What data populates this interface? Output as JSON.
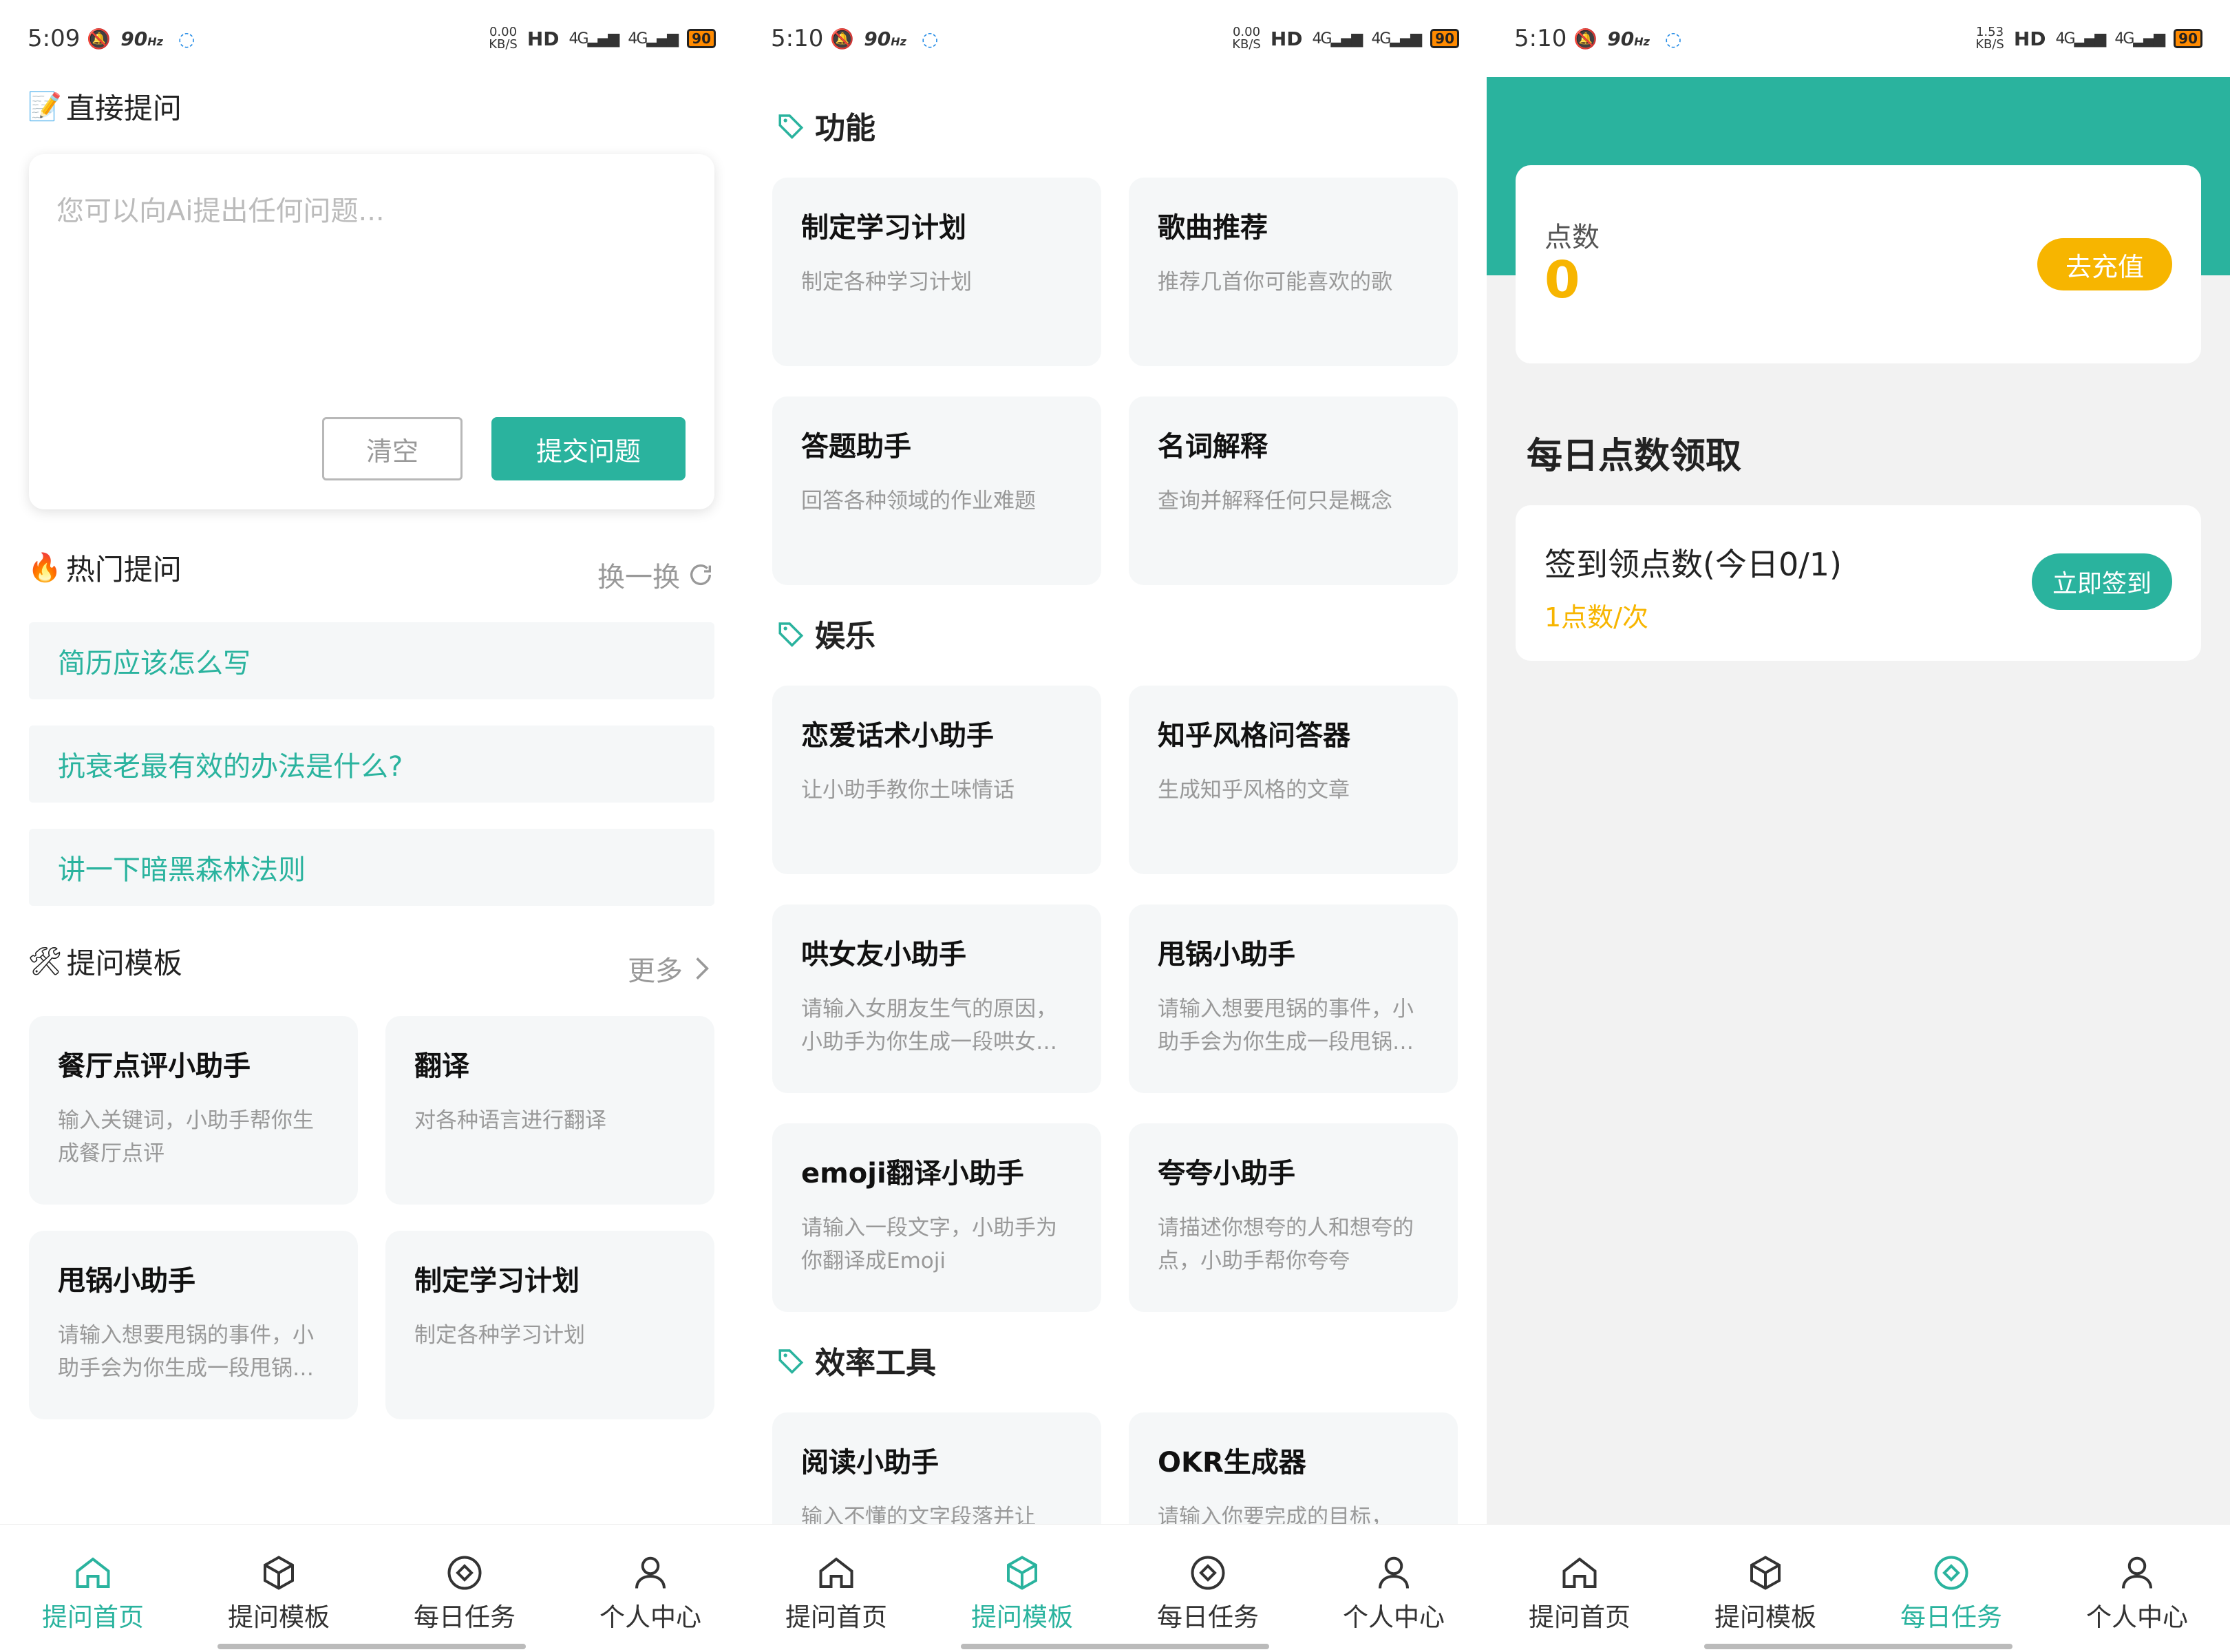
{
  "screens": [
    {
      "status": {
        "time": "5:09",
        "hz": "90",
        "hz_unit": "Hz",
        "speed": "0.00",
        "speed_unit": "KB/S",
        "hd": "HD",
        "net1": "4G",
        "net2": "4G",
        "battery": "90"
      },
      "ask": {
        "title": "直接提问",
        "placeholder": "您可以向Ai提出任何问题...",
        "clear_label": "清空",
        "submit_label": "提交问题"
      },
      "hot": {
        "title": "热门提问",
        "refresh_label": "换一换",
        "items": [
          "简历应该怎么写",
          "抗衰老最有效的办法是什么?",
          "讲一下暗黑森林法则"
        ]
      },
      "templates": {
        "title": "提问模板",
        "more_label": "更多",
        "cards": [
          {
            "title": "餐厅点评小助手",
            "desc": "输入关键词，小助手帮你生成餐厅点评"
          },
          {
            "title": "翻译",
            "desc": "对各种语言进行翻译"
          },
          {
            "title": "甩锅小助手",
            "desc": "请输入想要甩锅的事件，小助手会为你生成一段甩锅的话"
          },
          {
            "title": "制定学习计划",
            "desc": "制定各种学习计划"
          }
        ]
      }
    },
    {
      "status": {
        "time": "5:10",
        "hz": "90",
        "hz_unit": "Hz",
        "speed": "0.00",
        "speed_unit": "KB/S",
        "hd": "HD",
        "net1": "4G",
        "net2": "4G",
        "battery": "90"
      },
      "categories": [
        {
          "name": "功能",
          "cards": [
            {
              "title": "制定学习计划",
              "desc": "制定各种学习计划"
            },
            {
              "title": "歌曲推荐",
              "desc": "推荐几首你可能喜欢的歌"
            },
            {
              "title": "答题助手",
              "desc": "回答各种领域的作业难题"
            },
            {
              "title": "名词解释",
              "desc": "查询并解释任何只是概念"
            }
          ]
        },
        {
          "name": "娱乐",
          "cards": [
            {
              "title": "恋爱话术小助手",
              "desc": "让小助手教你土味情话"
            },
            {
              "title": "知乎风格问答器",
              "desc": "生成知乎风格的文章"
            },
            {
              "title": "哄女友小助手",
              "desc": "请输入女朋友生气的原因，小助手为你生成一段哄女友的话"
            },
            {
              "title": "甩锅小助手",
              "desc": "请输入想要甩锅的事件，小助手会为你生成一段甩锅的话"
            },
            {
              "title": "emoji翻译小助手",
              "desc": "请输入一段文字，小助手为你翻译成Emoji"
            },
            {
              "title": "夸夸小助手",
              "desc": "请描述你想夸的人和想夸的点，小助手帮你夸夸"
            }
          ]
        },
        {
          "name": "效率工具",
          "cards": [
            {
              "title": "阅读小助手",
              "desc": "输入不懂的文字段落并让"
            },
            {
              "title": "OKR生成器",
              "desc": "请输入你要完成的目标，"
            }
          ]
        }
      ]
    },
    {
      "status": {
        "time": "5:10",
        "hz": "90",
        "hz_unit": "Hz",
        "speed": "1.53",
        "speed_unit": "KB/S",
        "hd": "HD",
        "net1": "4G",
        "net2": "4G",
        "battery": "90"
      },
      "points": {
        "label": "点数",
        "value": "0",
        "recharge_label": "去充值"
      },
      "daily": {
        "title": "每日点数领取",
        "task_title": "签到领点数(今日0/1)",
        "task_sub": "1点数/次",
        "sign_label": "立即签到"
      }
    }
  ],
  "tabs": [
    {
      "label": "提问首页",
      "icon": "home-icon"
    },
    {
      "label": "提问模板",
      "icon": "cube-icon"
    },
    {
      "label": "每日任务",
      "icon": "target-icon"
    },
    {
      "label": "个人中心",
      "icon": "user-icon"
    }
  ],
  "colors": {
    "accent": "#2ab39e",
    "gold": "#f7b500",
    "muted": "#999999",
    "card": "#f5f7f8"
  }
}
